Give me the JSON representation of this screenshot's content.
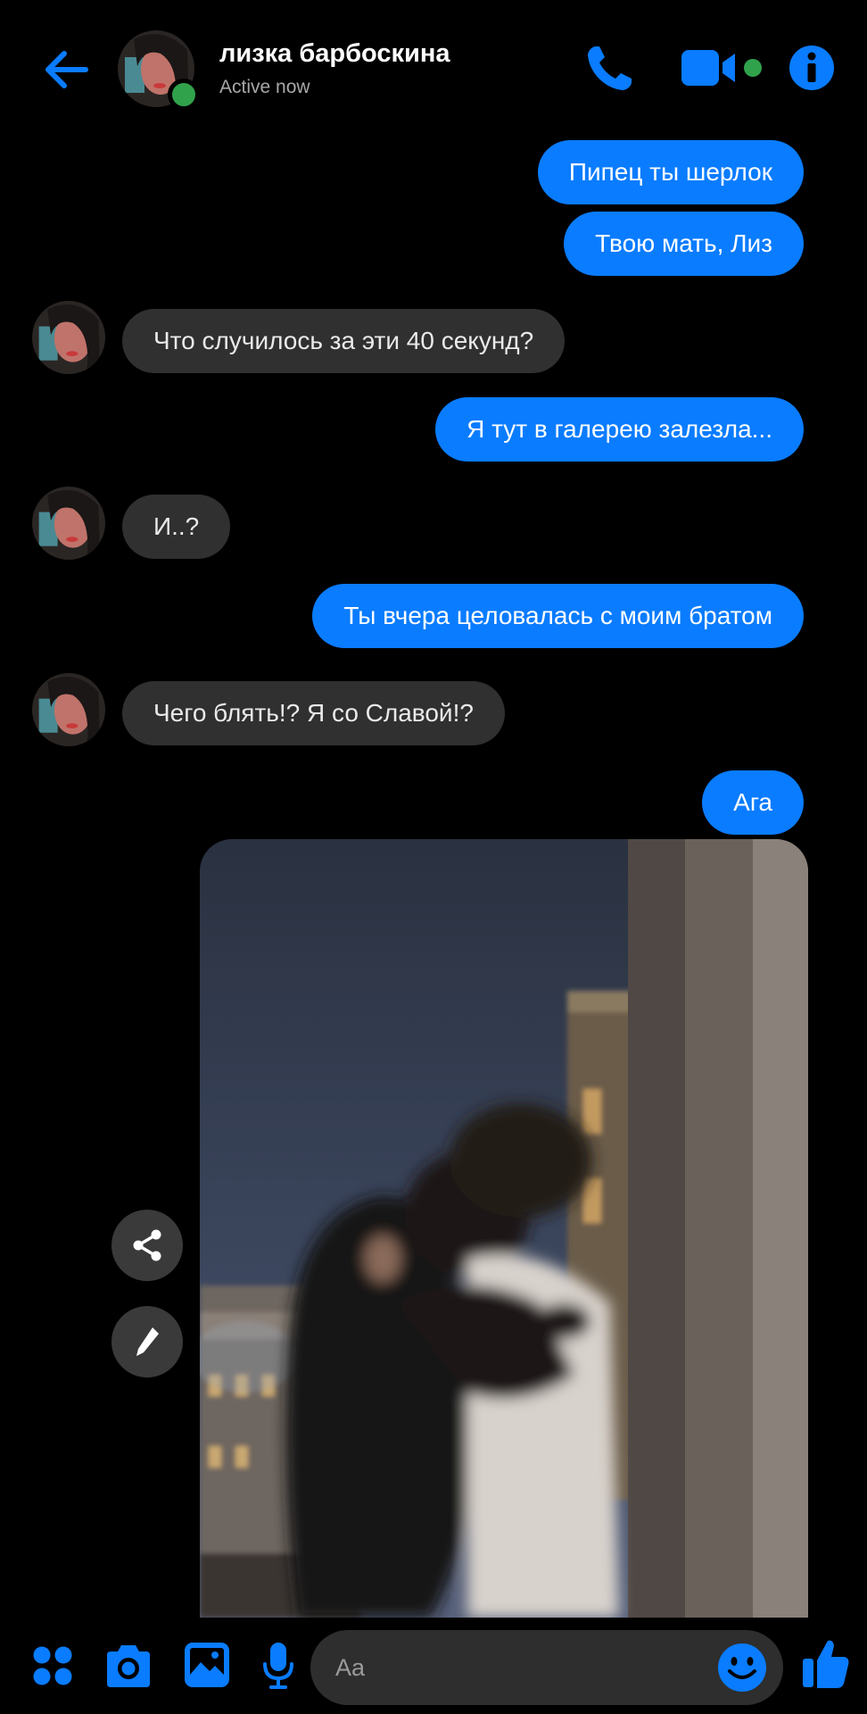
{
  "header": {
    "contact_name": "лизка барбоскина",
    "status": "Active now",
    "icons": [
      "back-arrow-icon",
      "phone-icon",
      "video-camera-icon",
      "info-icon"
    ]
  },
  "messages": [
    {
      "side": "out",
      "text": "Пипец ты шерлок"
    },
    {
      "side": "out",
      "text": "Твою мать, Лиз"
    },
    {
      "side": "in",
      "text": "Что случилось за эти 40 секунд?"
    },
    {
      "side": "out",
      "text": "Я тут в галерею залезла..."
    },
    {
      "side": "in",
      "text": "И..?"
    },
    {
      "side": "out",
      "text": "Ты вчера целовалась с моим братом"
    },
    {
      "side": "in",
      "text": "Чего блять!? Я со Славой!?"
    },
    {
      "side": "out",
      "text": "Ага"
    }
  ],
  "photo_actions": [
    "share-icon",
    "edit-pencil-icon"
  ],
  "composer": {
    "placeholder": "Aa",
    "icons": [
      "apps-grid-icon",
      "camera-icon",
      "gallery-icon",
      "microphone-icon",
      "emoji-icon",
      "thumbs-up-icon"
    ]
  },
  "colors": {
    "accent": "#0a7cff",
    "incoming": "#303030",
    "online": "#31a24c",
    "background": "#000000"
  }
}
